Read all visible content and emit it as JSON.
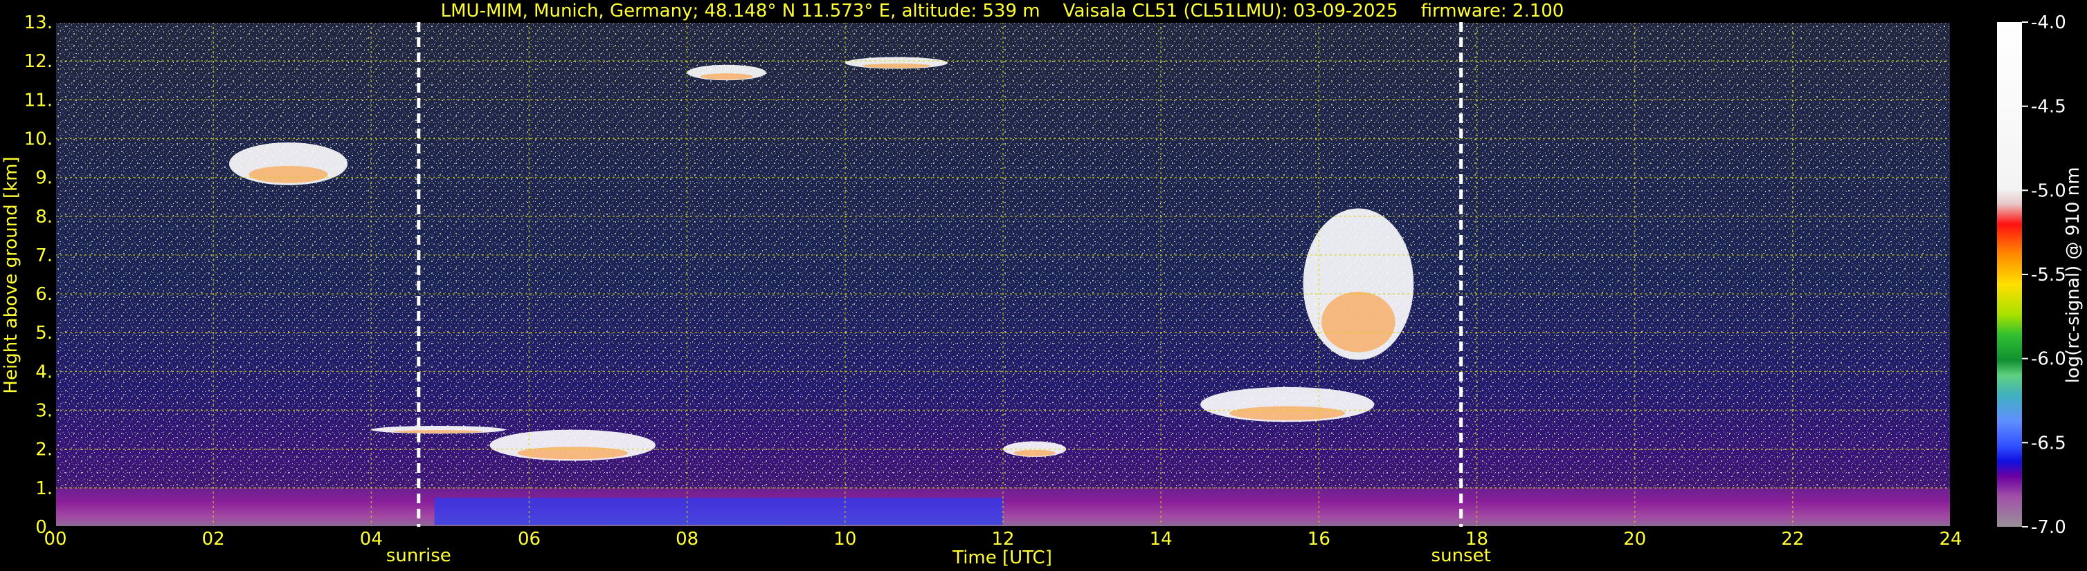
{
  "chart_data": {
    "type": "heatmap",
    "title": "LMU-MIM, Munich, Germany; 48.148° N 11.573° E, altitude: 539 m    Vaisala CL51 (CL51LMU): 03-09-2025    firmware: 2.100",
    "xlabel": "Time [UTC]",
    "ylabel": "Height above ground [km]",
    "xlim": [
      0,
      24
    ],
    "ylim": [
      0,
      13
    ],
    "x_ticks": [
      "00",
      "02",
      "04",
      "06",
      "08",
      "10",
      "12",
      "14",
      "16",
      "18",
      "20",
      "22",
      "24"
    ],
    "y_ticks": [
      "0.",
      "1.",
      "2.",
      "3.",
      "4.",
      "5.",
      "6.",
      "7.",
      "8.",
      "9.",
      "10.",
      "11.",
      "12.",
      "13."
    ],
    "grid": true,
    "markers": [
      {
        "name": "sunrise",
        "x": 4.6
      },
      {
        "name": "sunset",
        "x": 17.8
      }
    ],
    "colorbar": {
      "label": "log(rc-signal) @ 910 nm",
      "range": [
        -7.0,
        -4.0
      ],
      "ticks": [
        "-4.0",
        "-4.5",
        "-5.0",
        "-5.5",
        "-6.0",
        "-6.5",
        "-7.0"
      ]
    },
    "features": [
      {
        "kind": "boundary layer aerosol",
        "t_start": 0,
        "t_end": 24,
        "h_bottom": 0,
        "h_top": 1.0
      },
      {
        "kind": "cloud",
        "t_start": 4.0,
        "t_end": 5.7,
        "h_bottom": 2.4,
        "h_top": 2.6
      },
      {
        "kind": "cloud",
        "t_start": 5.5,
        "t_end": 7.6,
        "h_bottom": 1.7,
        "h_top": 2.5
      },
      {
        "kind": "cloud",
        "t_start": 8.0,
        "t_end": 9.0,
        "h_bottom": 11.5,
        "h_top": 11.9
      },
      {
        "kind": "cloud",
        "t_start": 10.0,
        "t_end": 11.3,
        "h_bottom": 11.8,
        "h_top": 12.1
      },
      {
        "kind": "cloud",
        "t_start": 12.0,
        "t_end": 12.8,
        "h_bottom": 1.8,
        "h_top": 2.2
      },
      {
        "kind": "cloud",
        "t_start": 14.5,
        "t_end": 16.7,
        "h_bottom": 2.7,
        "h_top": 3.6
      },
      {
        "kind": "cloud",
        "t_start": 15.8,
        "t_end": 17.2,
        "h_bottom": 4.3,
        "h_top": 8.2
      },
      {
        "kind": "cloud",
        "t_start": 2.2,
        "t_end": 3.7,
        "h_bottom": 8.8,
        "h_top": 9.9
      }
    ]
  },
  "colors": {
    "text": "#ffff33",
    "background": "#000000",
    "grid": "#d4d400",
    "marker": "#ffffff"
  }
}
